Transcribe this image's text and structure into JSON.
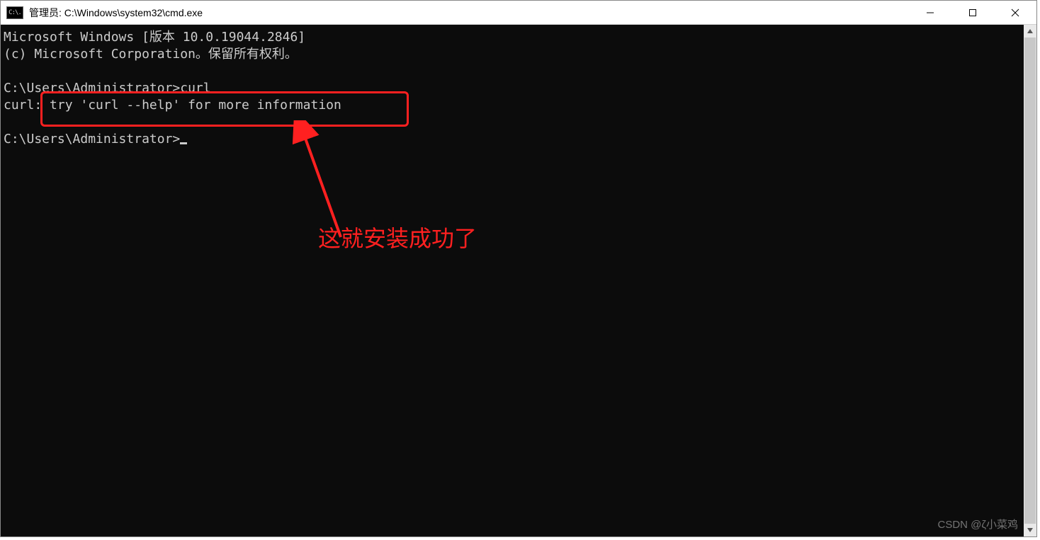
{
  "window": {
    "icon_text": "C:\\.",
    "title": "管理员: C:\\Windows\\system32\\cmd.exe"
  },
  "terminal": {
    "line1": "Microsoft Windows [版本 10.0.19044.2846]",
    "line2": "(c) Microsoft Corporation。保留所有权利。",
    "blank1": "",
    "line3": "C:\\Users\\Administrator>curl",
    "line4": "curl: try 'curl --help' for more information",
    "blank2": "",
    "line5": "C:\\Users\\Administrator>"
  },
  "annotation": {
    "caption": "这就安装成功了"
  },
  "watermark": "CSDN @ζ小菜鸡"
}
